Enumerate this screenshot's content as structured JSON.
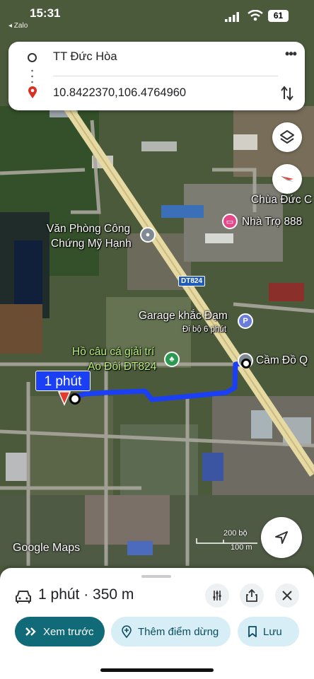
{
  "status_bar": {
    "time": "15:31",
    "back_app": "◂ Zalo",
    "battery": "61"
  },
  "route": {
    "origin": "TT Đức Hòa",
    "destination": "10.8422370,106.4764960",
    "more_icon": "more-horiz-icon",
    "swap_icon": "swap-vert-icon"
  },
  "map": {
    "labels": {
      "chua": "Chùa Đức C",
      "nha_tro": "Nhà Trọ 888",
      "van_phong_1": "Văn Phòng Công",
      "van_phong_2": "Chứng Mỹ Hạnh",
      "road_badge": "DT824",
      "garage": "Garage khắc Đạm",
      "garage_sub": "Đi bộ 6 phút",
      "ho_cau_1": "Hồ câu cá giải trí",
      "ho_cau_2": "Ao Đôi ĐT824",
      "cam_do": "Cầm Đồ Q",
      "route_time": "1 phút",
      "google": "Google Maps",
      "scale_ft": "200 bộ",
      "scale_m": "100 m"
    },
    "route_color": "#1a3ff5"
  },
  "sheet": {
    "summary": "1 phút · 350 m",
    "preview_label": "Xem trước",
    "add_stop_label": "Thêm điểm dừng",
    "save_label": "Lưu"
  },
  "colors": {
    "accent": "#116a78",
    "chip_bg": "#d8eef6",
    "route": "#1a3ff5"
  }
}
